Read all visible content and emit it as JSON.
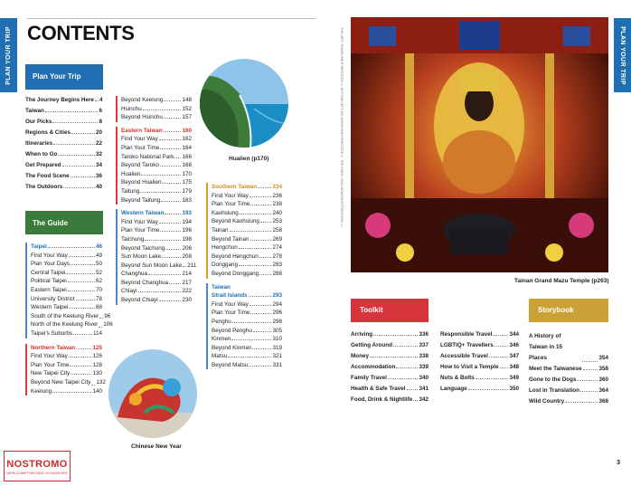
{
  "side_tab": "PLAN YOUR TRIP",
  "title": "CONTENTS",
  "plan_your_trip": {
    "header": "Plan Your Trip",
    "items": [
      {
        "label": "The Journey Begins Here",
        "page": "4"
      },
      {
        "label": "Taiwan",
        "page": "6"
      },
      {
        "label": "Our Picks",
        "page": "8"
      },
      {
        "label": "Regions & Cities",
        "page": "20"
      },
      {
        "label": "Itineraries",
        "page": "22"
      },
      {
        "label": "When to Go",
        "page": "32"
      },
      {
        "label": "Get Prepared",
        "page": "34"
      },
      {
        "label": "The Food Scene",
        "page": "36"
      },
      {
        "label": "The Outdoors",
        "page": "40"
      }
    ]
  },
  "the_guide": {
    "header": "The Guide",
    "taipei": {
      "head": {
        "label": "Taipei",
        "page": "46"
      },
      "items": [
        {
          "label": "Find Your Way",
          "page": "49"
        },
        {
          "label": "Plan Your Days",
          "page": "50"
        },
        {
          "label": "Central Taipei",
          "page": "52"
        },
        {
          "label": "Political Taipei",
          "page": "62"
        },
        {
          "label": "Eastern Taipei",
          "page": "70"
        },
        {
          "label": "University District",
          "page": "78"
        },
        {
          "label": "Western Taipei",
          "page": "88"
        },
        {
          "label": "South of the Keelung River",
          "page": "96"
        },
        {
          "label": "North of the Keelung River",
          "page": "106"
        },
        {
          "label": "Taipei's Suburbs",
          "page": "114"
        }
      ]
    },
    "northern": {
      "head": {
        "label": "Northern Taiwan",
        "page": "125"
      },
      "items": [
        {
          "label": "Find Your Way",
          "page": "126"
        },
        {
          "label": "Plan Your Time",
          "page": "128"
        },
        {
          "label": "New Taipei City",
          "page": "130"
        },
        {
          "label": "Beyond New Taipei City",
          "page": "132"
        },
        {
          "label": "Keelung",
          "page": "140"
        }
      ]
    }
  },
  "col2_top": [
    {
      "label": "Beyond Keelung",
      "page": "148"
    },
    {
      "label": "Hsinchu",
      "page": "152"
    },
    {
      "label": "Beyond Hsinchu",
      "page": "157"
    }
  ],
  "eastern": {
    "head": {
      "label": "Eastern Taiwan",
      "page": "160"
    },
    "items": [
      {
        "label": "Find Your Way",
        "page": "162"
      },
      {
        "label": "Plan Your Time",
        "page": "164"
      },
      {
        "label": "Taroko National Park",
        "page": "166"
      },
      {
        "label": "Beyond Taroko",
        "page": "168"
      },
      {
        "label": "Hualien",
        "page": "170"
      },
      {
        "label": "Beyond Hualien",
        "page": "175"
      },
      {
        "label": "Taitung",
        "page": "179"
      },
      {
        "label": "Beyond Taitung",
        "page": "183"
      }
    ]
  },
  "western": {
    "head": {
      "label": "Western Taiwan",
      "page": "193"
    },
    "items": [
      {
        "label": "Find Your Way",
        "page": "194"
      },
      {
        "label": "Plan Your Time",
        "page": "196"
      },
      {
        "label": "Taichung",
        "page": "198"
      },
      {
        "label": "Beyond Taichung",
        "page": "206"
      },
      {
        "label": "Sun Moon Lake",
        "page": "208"
      },
      {
        "label": "Beyond Sun Moon Lake",
        "page": "211"
      },
      {
        "label": "Changhua",
        "page": "214"
      },
      {
        "label": "Beyond Changhua",
        "page": "217"
      },
      {
        "label": "Chiayi",
        "page": "222"
      },
      {
        "label": "Beyond Chiayi",
        "page": "230"
      }
    ]
  },
  "southern": {
    "head": {
      "label": "Southern Taiwan",
      "page": "234"
    },
    "items": [
      {
        "label": "Find Your Way",
        "page": "236"
      },
      {
        "label": "Plan Your Time",
        "page": "238"
      },
      {
        "label": "Kaohsiung",
        "page": "240"
      },
      {
        "label": "Beyond Kaohsiung",
        "page": "253"
      },
      {
        "label": "Tainan",
        "page": "258"
      },
      {
        "label": "Beyond Tainan",
        "page": "269"
      },
      {
        "label": "Hengchun",
        "page": "274"
      },
      {
        "label": "Beyond Hengchun",
        "page": "278"
      },
      {
        "label": "Donggang",
        "page": "283"
      },
      {
        "label": "Beyond Donggang",
        "page": "288"
      }
    ]
  },
  "strait": {
    "head_line1": "Taiwan",
    "head": {
      "label": "Strait Islands",
      "page": "293"
    },
    "items": [
      {
        "label": "Find Your Way",
        "page": "294"
      },
      {
        "label": "Plan Your Time",
        "page": "296"
      },
      {
        "label": "Penghu",
        "page": "298"
      },
      {
        "label": "Beyond Penghu",
        "page": "305"
      },
      {
        "label": "Kinmen",
        "page": "310"
      },
      {
        "label": "Beyond Kinmen",
        "page": "319"
      },
      {
        "label": "Matsu",
        "page": "321"
      },
      {
        "label": "Beyond Matsu",
        "page": "331"
      }
    ]
  },
  "captions": {
    "hualien": "Hualien (p170)",
    "chinese_new_year": "Chinese New Year",
    "temple": "Tainan Grand Mazu Temple (p263)"
  },
  "photo_credit": "TOP LEFT: TRAVEL/SHUTTERSTOCK © BOTTOM LEFT: MO WONG/SHUTTERSTOCK © TOP RIGHT: JACK HONG/SHUTTERSTOCK ©",
  "toolkit": {
    "header": "Toolkit",
    "col1": [
      {
        "label": "Arriving",
        "page": "336"
      },
      {
        "label": "Getting Around",
        "page": "337"
      },
      {
        "label": "Money",
        "page": "338"
      },
      {
        "label": "Accommodation",
        "page": "339"
      },
      {
        "label": "Family Travel",
        "page": "340"
      },
      {
        "label": "Health & Safe Travel",
        "page": "341"
      },
      {
        "label": "Food, Drink & Nightlife",
        "page": "342"
      }
    ],
    "col2": [
      {
        "label": "Responsible Travel",
        "page": "344"
      },
      {
        "label": "LGBTIQ+ Travellers",
        "page": "346"
      },
      {
        "label": "Accessible Travel",
        "page": "347"
      },
      {
        "label": "How to Visit a Temple",
        "page": "348"
      },
      {
        "label": "Nuts & Bolts",
        "page": "349"
      },
      {
        "label": "Language",
        "page": "350"
      }
    ]
  },
  "storybook": {
    "header": "Storybook",
    "items": [
      {
        "label": "A History of Taiwan in 15 Places",
        "page": "354"
      },
      {
        "label": "Meet the Taiwanese",
        "page": "358"
      },
      {
        "label": "Gone to the Dogs",
        "page": "360"
      },
      {
        "label": "Lost in Translation",
        "page": "364"
      },
      {
        "label": "Wild Country",
        "page": "368"
      }
    ]
  },
  "page_number": "3",
  "logo": {
    "name": "NOSTROMO",
    "tagline": "WEB COMPTOIR DES VOYAGEURS"
  },
  "colors": {
    "plan": "#1f6fb2",
    "guide": "#3a7a3a",
    "toolkit": "#d7353b",
    "storybook": "#c9a134"
  }
}
